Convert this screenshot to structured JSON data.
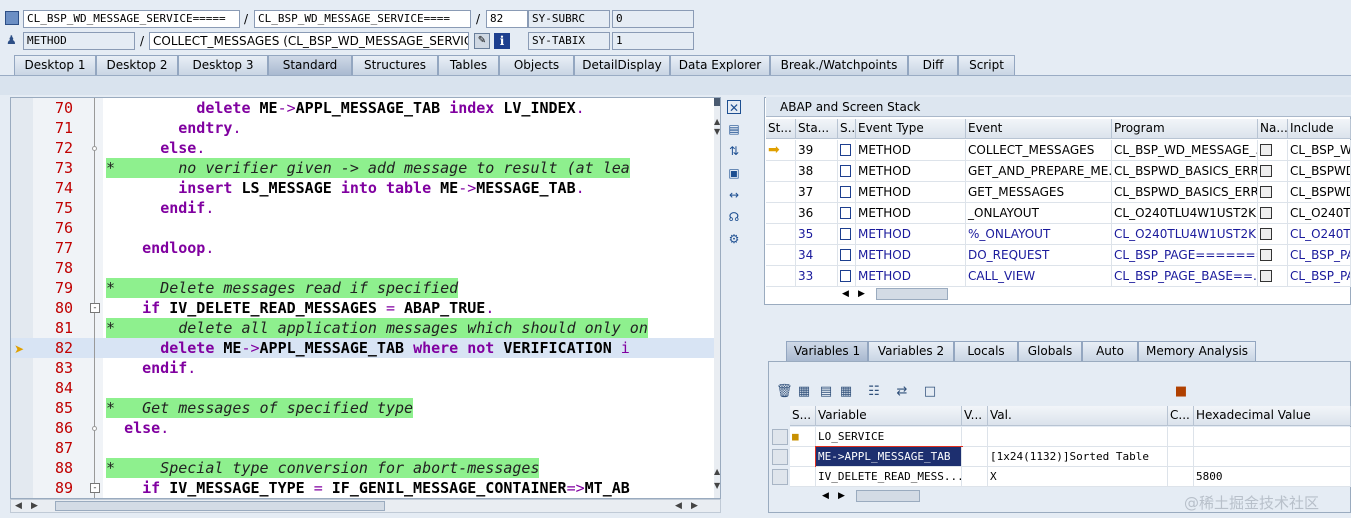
{
  "header": {
    "row1": {
      "field1": "CL_BSP_WD_MESSAGE_SERVICE=====",
      "sep1": "/",
      "field2": "CL_BSP_WD_MESSAGE_SERVICE====",
      "sep2": "/",
      "line": "82",
      "sysvar": "SY-SUBRC",
      "sysval": "0"
    },
    "row2": {
      "field1": "METHOD",
      "sep1": "/",
      "field2": "COLLECT_MESSAGES (CL_BSP_WD_MESSAGE_SERVICE)",
      "info_icon": "i",
      "sysvar": "SY-TABIX",
      "sysval": "1"
    }
  },
  "tabs": [
    "Desktop 1",
    "Desktop 2",
    "Desktop 3",
    "Standard",
    "Structures",
    "Tables",
    "Objects",
    "DetailDisplay",
    "Data Explorer",
    "Break./Watchpoints",
    "Diff",
    "Script"
  ],
  "active_tab": "Standard",
  "code_lines": [
    {
      "num": "70",
      "text": "          delete ME->APPL_MESSAGE_TAB index LV_INDEX.",
      "type": "code"
    },
    {
      "num": "71",
      "text": "        endtry.",
      "type": "code"
    },
    {
      "num": "72",
      "text": "      else.",
      "type": "code"
    },
    {
      "num": "73",
      "text": "*       no verifier given -> add message to result (at lea",
      "type": "comment"
    },
    {
      "num": "74",
      "text": "        insert LS_MESSAGE into table ME->MESSAGE_TAB.",
      "type": "code"
    },
    {
      "num": "75",
      "text": "      endif.",
      "type": "code"
    },
    {
      "num": "76",
      "text": "",
      "type": "code"
    },
    {
      "num": "77",
      "text": "    endloop.",
      "type": "code"
    },
    {
      "num": "78",
      "text": "",
      "type": "code"
    },
    {
      "num": "79",
      "text": "*     Delete messages read if specified",
      "type": "comment"
    },
    {
      "num": "80",
      "text": "    if IV_DELETE_READ_MESSAGES = ABAP_TRUE.",
      "type": "code"
    },
    {
      "num": "81",
      "text": "*       delete all application messages which should only on",
      "type": "comment"
    },
    {
      "num": "82",
      "text": "      delete ME->APPL_MESSAGE_TAB where not VERIFICATION i",
      "type": "code"
    },
    {
      "num": "83",
      "text": "    endif.",
      "type": "code"
    },
    {
      "num": "84",
      "text": "",
      "type": "code"
    },
    {
      "num": "85",
      "text": "*   Get messages of specified type",
      "type": "comment"
    },
    {
      "num": "86",
      "text": "  else.",
      "type": "code"
    },
    {
      "num": "87",
      "text": "",
      "type": "code"
    },
    {
      "num": "88",
      "text": "*     Special type conversion for abort-messages",
      "type": "comment"
    },
    {
      "num": "89",
      "text": "    if IV_MESSAGE_TYPE = IF_GENIL_MESSAGE_CONTAINER=>MT_AB",
      "type": "code"
    }
  ],
  "stack": {
    "title": "ABAP and Screen Stack",
    "columns": [
      "St...",
      "Sta...",
      "S...",
      "Event Type",
      "Event",
      "Program",
      "Na...",
      "Include"
    ],
    "rows": [
      {
        "level": "39",
        "type": "METHOD",
        "event": "COLLECT_MESSAGES",
        "program": "CL_BSP_WD_MESSAGE_...",
        "include": "CL_BSP_W",
        "current": true,
        "blue": false
      },
      {
        "level": "38",
        "type": "METHOD",
        "event": "GET_AND_PREPARE_ME...",
        "program": "CL_BSPWD_BASICS_ERR...",
        "include": "CL_BSPWD",
        "current": false,
        "blue": false
      },
      {
        "level": "37",
        "type": "METHOD",
        "event": "GET_MESSAGES",
        "program": "CL_BSPWD_BASICS_ERR...",
        "include": "CL_BSPWD",
        "current": false,
        "blue": false
      },
      {
        "level": "36",
        "type": "METHOD",
        "event": "_ONLAYOUT",
        "program": "CL_O240TLU4W1UST2K...",
        "include": "CL_O240TL",
        "current": false,
        "blue": false
      },
      {
        "level": "35",
        "type": "METHOD",
        "event": "%_ONLAYOUT",
        "program": "CL_O240TLU4W1UST2K...",
        "include": "CL_O240TL",
        "current": false,
        "blue": true
      },
      {
        "level": "34",
        "type": "METHOD",
        "event": "DO_REQUEST",
        "program": "CL_BSP_PAGE========...",
        "include": "CL_BSP_PA",
        "current": false,
        "blue": true
      },
      {
        "level": "33",
        "type": "METHOD",
        "event": "CALL_VIEW",
        "program": "CL_BSP_PAGE_BASE==...",
        "include": "CL_BSP_PA",
        "current": false,
        "blue": true
      }
    ]
  },
  "var_tabs": [
    "Variables 1",
    "Variables 2",
    "Locals",
    "Globals",
    "Auto",
    "Memory Analysis"
  ],
  "active_var_tab": "Variables 1",
  "variables": {
    "columns": [
      "S...",
      "Variable",
      "V...",
      "Val.",
      "C...",
      "Hexadecimal Value"
    ],
    "rows": [
      {
        "name": "LO_SERVICE",
        "value": "",
        "hex": "",
        "selected": false
      },
      {
        "name": "ME->APPL_MESSAGE_TAB",
        "value": "[1x24(1132)]Sorted Table",
        "hex": "",
        "selected": true
      },
      {
        "name": "IV_DELETE_READ_MESS...",
        "value": "X",
        "hex": "5800",
        "selected": false
      }
    ]
  },
  "watermark": "@稀土掘金技术社区",
  "colors": {
    "comment_bg": "#8ef08e",
    "keyword": "#8000a0",
    "line_number": "#c00000",
    "background": "#e5ecf4"
  }
}
